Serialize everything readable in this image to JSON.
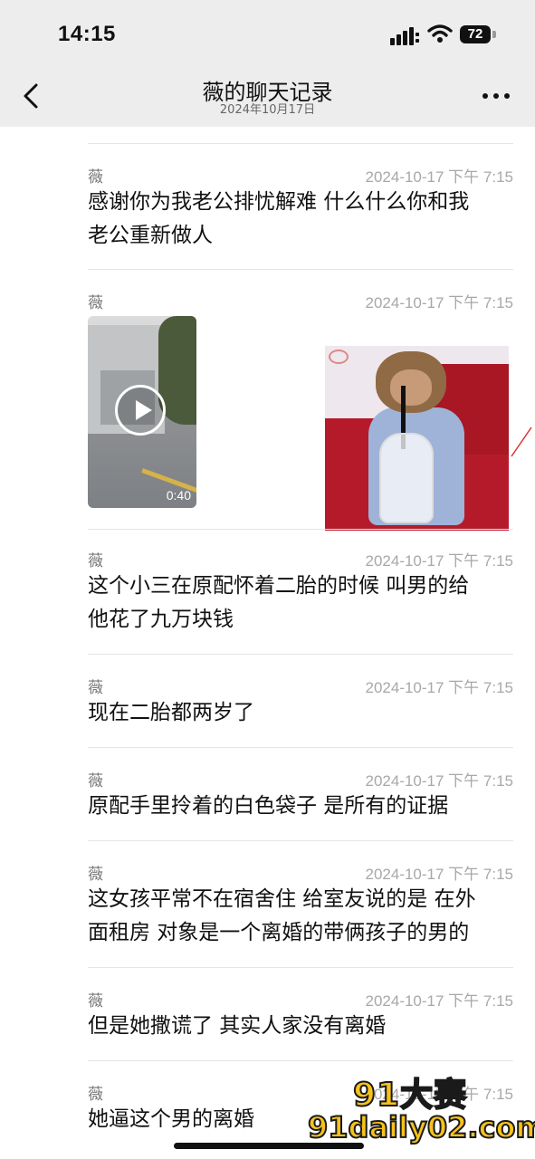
{
  "status_bar": {
    "time": "14:15",
    "battery": "72"
  },
  "nav": {
    "title": "薇的聊天记录",
    "subtitle": "2024年10月17日"
  },
  "messages": [
    {
      "sender": "薇",
      "time": "2024-10-17 下午 7:15",
      "text": [
        "感谢你为我老公排忧解难 什么什么你和我",
        "老公重新做人"
      ]
    },
    {
      "sender": "薇",
      "time": "2024-10-17 下午 7:15",
      "video_duration": "0:40"
    },
    {
      "sender": "薇",
      "time": "2024-10-17 下午 7:15",
      "text": [
        "这个小三在原配怀着二胎的时候 叫男的给",
        "他花了九万块钱"
      ]
    },
    {
      "sender": "薇",
      "time": "2024-10-17 下午 7:15",
      "text": [
        "现在二胎都两岁了"
      ]
    },
    {
      "sender": "薇",
      "time": "2024-10-17 下午 7:15",
      "text": [
        "原配手里拎着的白色袋子 是所有的证据"
      ]
    },
    {
      "sender": "薇",
      "time": "2024-10-17 下午 7:15",
      "text": [
        "这女孩平常不在宿舍住 给室友说的是 在外",
        "面租房 对象是一个离婚的带俩孩子的男的"
      ]
    },
    {
      "sender": "薇",
      "time": "2024-10-17 下午 7:15",
      "text": [
        "但是她撒谎了 其实人家没有离婚"
      ]
    },
    {
      "sender": "薇",
      "time": "2024-10-17 下午 7:15",
      "text": [
        "她逼这个男的离婚"
      ]
    }
  ],
  "watermark": {
    "line1": "91大赛",
    "line2": "91daily02.com"
  },
  "icons": {
    "back": "chevron-left-icon",
    "more": "more-dots-icon",
    "play": "play-icon",
    "signal": "cellular-signal-icon",
    "wifi": "wifi-icon",
    "battery": "battery-icon"
  }
}
